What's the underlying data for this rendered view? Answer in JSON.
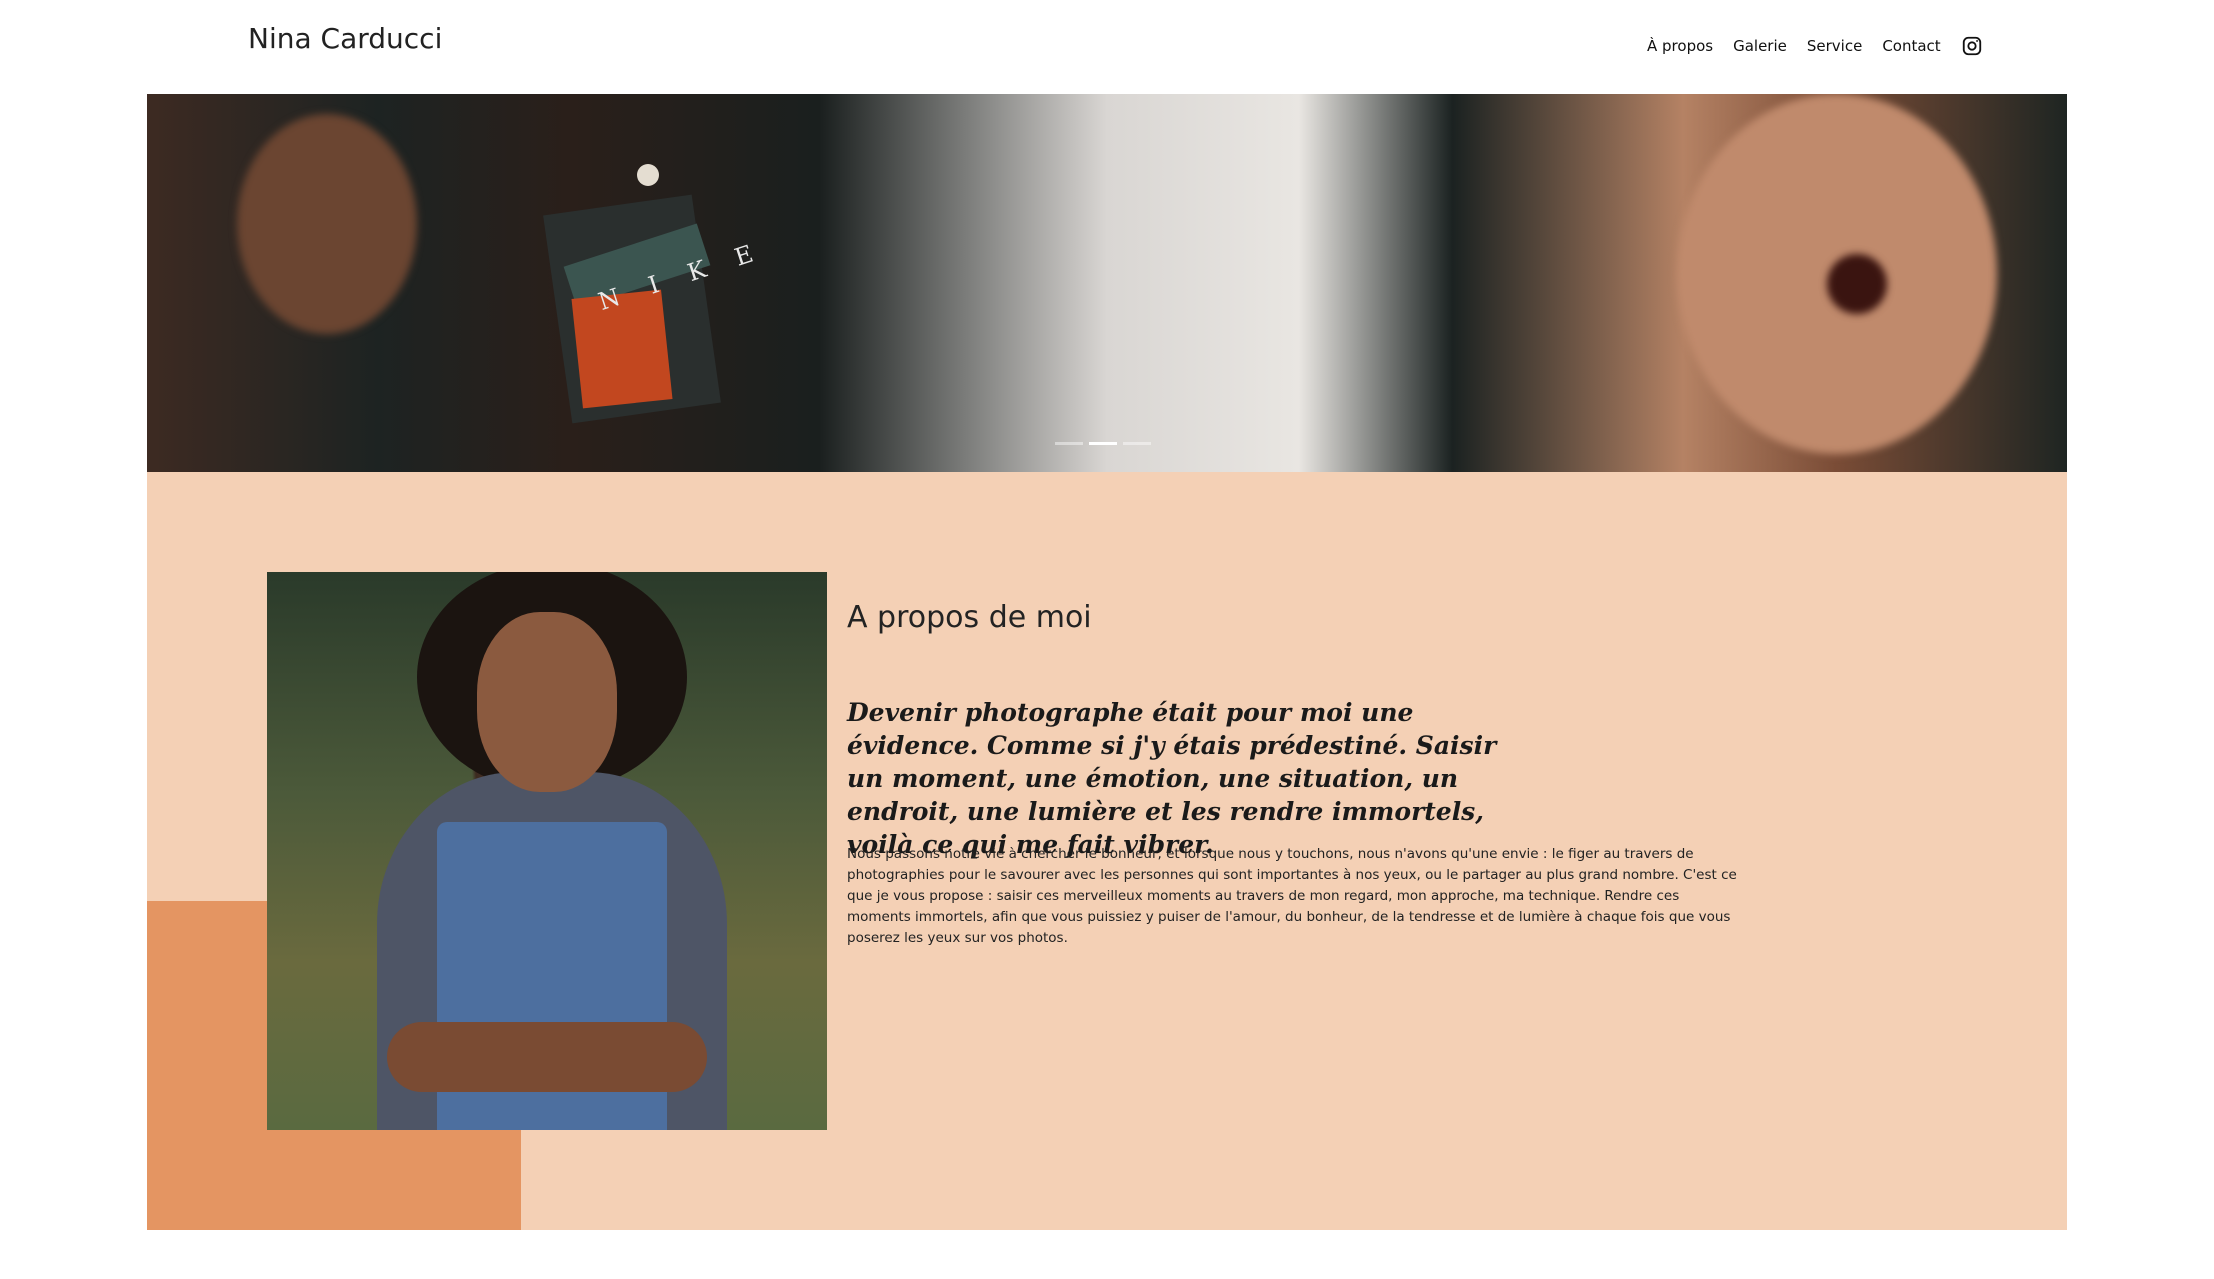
{
  "header": {
    "brand": "Nina Carducci",
    "nav": [
      "À propos",
      "Galerie",
      "Service",
      "Contact"
    ]
  },
  "hero": {
    "carousel_indicators": 3,
    "active_indicator": 2,
    "shirt_text": "N I K E"
  },
  "about": {
    "title": "A propos de moi",
    "quote": "Devenir photographe était pour moi une évidence. Comme si j'y étais prédestiné. Saisir un moment, une émotion, une situation, un endroit, une lumière et les rendre immortels, voilà ce qui me fait vibrer.",
    "body": "Nous passons notre vie à chercher le bonheur, et lorsque nous y touchons, nous n'avons qu'une envie : le figer au travers de photographies pour le savourer avec les personnes qui sont importantes à nos yeux, ou le partager au plus grand nombre. C'est ce que je vous propose : saisir ces merveilleux moments au travers de mon regard, mon approche, ma technique. Rendre ces moments immortels, afin que vous puissiez y puiser de l'amour, du bonheur, de la tendresse et de lumière à chaque fois que vous poserez les yeux sur vos photos."
  },
  "colors": {
    "about_bg": "#f4d0b5",
    "accent_block": "#e49562"
  },
  "icons": {
    "social": "instagram-icon"
  }
}
